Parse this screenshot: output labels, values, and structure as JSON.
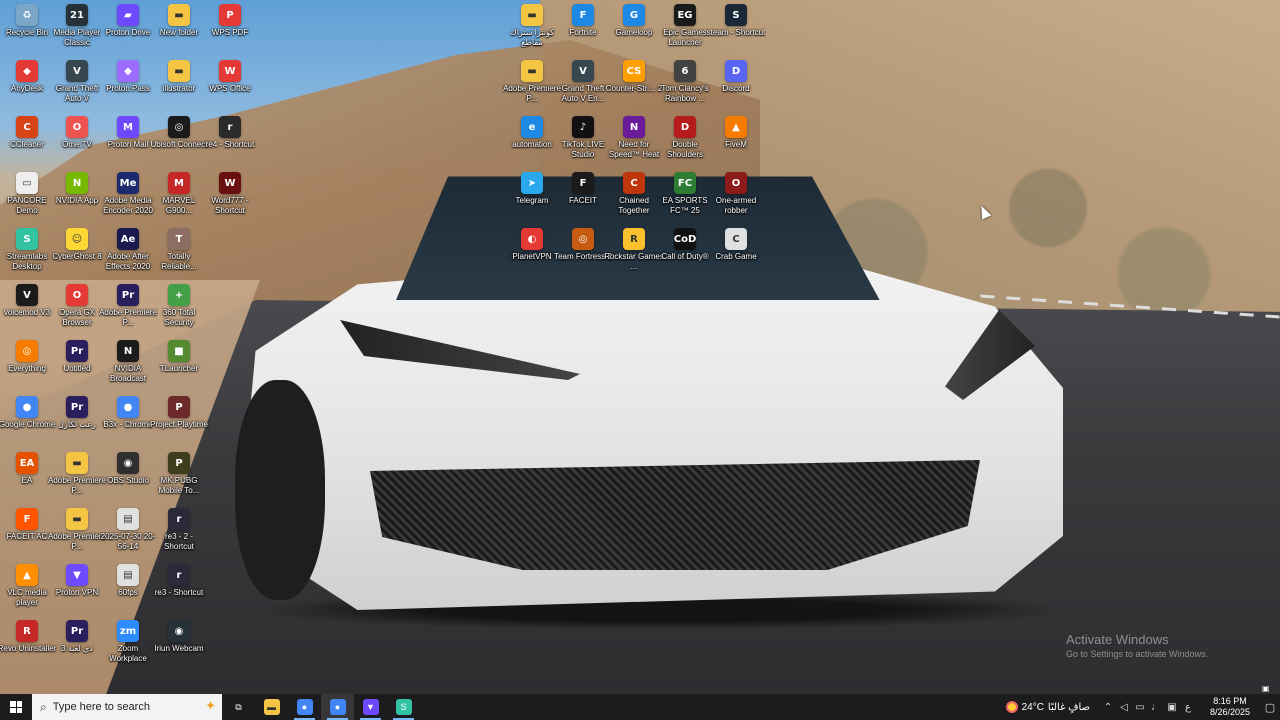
{
  "desktop_icons": [
    {
      "label": "Recycle Bin",
      "icon": "recycle-bin-icon",
      "color": "#7aa7c7",
      "glyph": "♻",
      "col": 0,
      "row": 0
    },
    {
      "label": "AnyDesk",
      "icon": "anydesk-icon",
      "color": "#e53935",
      "glyph": "◆",
      "col": 0,
      "row": 1
    },
    {
      "label": "CCleaner",
      "icon": "ccleaner-icon",
      "color": "#d84315",
      "glyph": "C",
      "col": 0,
      "row": 2
    },
    {
      "label": "PANCORE Demo",
      "icon": "document-icon",
      "color": "#eeeeee",
      "glyph": "▭",
      "col": 0,
      "row": 3
    },
    {
      "label": "Streamlabs Desktop",
      "icon": "streamlabs-icon",
      "color": "#31c3a2",
      "glyph": "S",
      "col": 0,
      "row": 4
    },
    {
      "label": "voicemod V3",
      "icon": "voicemod-icon",
      "color": "#1b1b1b",
      "glyph": "V",
      "col": 0,
      "row": 5
    },
    {
      "label": "Everything",
      "icon": "everything-icon",
      "color": "#f57c00",
      "glyph": "◎",
      "col": 0,
      "row": 6
    },
    {
      "label": "Google Chrome",
      "icon": "chrome-icon",
      "color": "#4285f4",
      "glyph": "●",
      "col": 0,
      "row": 7
    },
    {
      "label": "EA",
      "icon": "ea-icon",
      "color": "#e65100",
      "glyph": "EA",
      "col": 0,
      "row": 8
    },
    {
      "label": "FACEIT AC",
      "icon": "faceit-ac-icon",
      "color": "#ff5500",
      "glyph": "F",
      "col": 0,
      "row": 9
    },
    {
      "label": "VLC media player",
      "icon": "vlc-icon",
      "color": "#ff8f00",
      "glyph": "▲",
      "col": 0,
      "row": 10
    },
    {
      "label": "Revo Uninstaller",
      "icon": "revo-icon",
      "color": "#c62828",
      "glyph": "R",
      "col": 0,
      "row": 11
    },
    {
      "label": "Media Player Classic",
      "icon": "media-player-icon",
      "color": "#263238",
      "glyph": "21",
      "col": 1,
      "row": 0
    },
    {
      "label": "Grand Theft Auto V",
      "icon": "gta-icon",
      "color": "#37474f",
      "glyph": "V",
      "col": 1,
      "row": 1
    },
    {
      "label": "Ome.TV",
      "icon": "ome-tv-icon",
      "color": "#ef5350",
      "glyph": "O",
      "col": 1,
      "row": 2
    },
    {
      "label": "NVIDIA App",
      "icon": "nvidia-icon",
      "color": "#76b900",
      "glyph": "N",
      "col": 1,
      "row": 3
    },
    {
      "label": "CyberGhost 8",
      "icon": "cyberghost-icon",
      "color": "#fdd835",
      "glyph": "☺",
      "col": 1,
      "row": 4
    },
    {
      "label": "Opera GX Browser",
      "icon": "opera-gx-icon",
      "color": "#e53935",
      "glyph": "O",
      "col": 1,
      "row": 5
    },
    {
      "label": "Untitled",
      "icon": "premiere-icon",
      "color": "#2a1e5c",
      "glyph": "Pr",
      "col": 1,
      "row": 6
    },
    {
      "label": "رعب لكارل",
      "icon": "premiere-icon",
      "color": "#2a1e5c",
      "glyph": "Pr",
      "col": 1,
      "row": 7
    },
    {
      "label": "Adobe Premiere P...",
      "icon": "folder-icon",
      "color": "#f4c542",
      "glyph": "▬",
      "col": 1,
      "row": 8
    },
    {
      "label": "Adobe Premiere P...",
      "icon": "folder-icon",
      "color": "#f4c542",
      "glyph": "▬",
      "col": 1,
      "row": 9
    },
    {
      "label": "Proton VPN",
      "icon": "proton-vpn-icon",
      "color": "#6d4aff",
      "glyph": "▼",
      "col": 1,
      "row": 10
    },
    {
      "label": "3 دي لعبة",
      "icon": "premiere-icon",
      "color": "#2a1e5c",
      "glyph": "Pr",
      "col": 1,
      "row": 11
    },
    {
      "label": "Proton Drive",
      "icon": "proton-drive-icon",
      "color": "#6d4aff",
      "glyph": "▰",
      "col": 2,
      "row": 0
    },
    {
      "label": "Proton Pass",
      "icon": "proton-pass-icon",
      "color": "#9c6cff",
      "glyph": "◆",
      "col": 2,
      "row": 1
    },
    {
      "label": "Proton Mail",
      "icon": "proton-mail-icon",
      "color": "#6d4aff",
      "glyph": "M",
      "col": 2,
      "row": 2
    },
    {
      "label": "Adobe Media Encoder 2020",
      "icon": "media-encoder-icon",
      "color": "#1a2a6c",
      "glyph": "Me",
      "col": 2,
      "row": 3
    },
    {
      "label": "Adobe After Effects 2020",
      "icon": "after-effects-icon",
      "color": "#1a1a4e",
      "glyph": "Ae",
      "col": 2,
      "row": 4
    },
    {
      "label": "Adobe Premiere P...",
      "icon": "premiere-icon",
      "color": "#2a1e5c",
      "glyph": "Pr",
      "col": 2,
      "row": 5
    },
    {
      "label": "NVIDIA Broadcast",
      "icon": "nvidia-broadcast-icon",
      "color": "#1b1b1b",
      "glyph": "N",
      "col": 2,
      "row": 6
    },
    {
      "label": "B3x - Chrome",
      "icon": "chrome-icon",
      "color": "#4285f4",
      "glyph": "●",
      "col": 2,
      "row": 7
    },
    {
      "label": "OBS Studio",
      "icon": "obs-icon",
      "color": "#302e31",
      "glyph": "◉",
      "col": 2,
      "row": 8
    },
    {
      "label": "2025-07-30 20-56-14",
      "icon": "video-file-icon",
      "color": "#e0e0e0",
      "glyph": "▤",
      "col": 2,
      "row": 9
    },
    {
      "label": "60fps",
      "icon": "video-file-icon",
      "color": "#e0e0e0",
      "glyph": "▤",
      "col": 2,
      "row": 10
    },
    {
      "label": "Zoom Workplace",
      "icon": "zoom-icon",
      "color": "#2d8cff",
      "glyph": "zm",
      "col": 2,
      "row": 11
    },
    {
      "label": "New folder",
      "icon": "folder-icon",
      "color": "#f4c542",
      "glyph": "▬",
      "col": 3,
      "row": 0
    },
    {
      "label": "illustrator",
      "icon": "folder-icon",
      "color": "#f4c542",
      "glyph": "▬",
      "col": 3,
      "row": 1
    },
    {
      "label": "Ubisoft Connect",
      "icon": "ubisoft-icon",
      "color": "#1b1b1b",
      "glyph": "◎",
      "col": 3,
      "row": 2
    },
    {
      "label": "MARVEL G900...",
      "icon": "marvel-icon",
      "color": "#c62828",
      "glyph": "M",
      "col": 3,
      "row": 3
    },
    {
      "label": "Totally Reliable...",
      "icon": "game-icon",
      "color": "#8d6e63",
      "glyph": "T",
      "col": 3,
      "row": 4
    },
    {
      "label": "360 Total Security",
      "icon": "total-security-icon",
      "color": "#43a047",
      "glyph": "+",
      "col": 3,
      "row": 5
    },
    {
      "label": "TLauncher",
      "icon": "tlauncher-icon",
      "color": "#558b2f",
      "glyph": "■",
      "col": 3,
      "row": 6
    },
    {
      "label": "Project Playtime",
      "icon": "game-icon",
      "color": "#6d2a2a",
      "glyph": "P",
      "col": 3,
      "row": 7
    },
    {
      "label": "MK PUBG Mobile To...",
      "icon": "pubg-icon",
      "color": "#3e3e1e",
      "glyph": "P",
      "col": 3,
      "row": 8
    },
    {
      "label": "re3 - 2 - Shortcut",
      "icon": "game-icon",
      "color": "#2a2a3a",
      "glyph": "r",
      "col": 3,
      "row": 9
    },
    {
      "label": "re3 - Shortcut",
      "icon": "game-icon",
      "color": "#2a2a3a",
      "glyph": "r",
      "col": 3,
      "row": 10
    },
    {
      "label": "Iriun Webcam",
      "icon": "webcam-icon",
      "color": "#263238",
      "glyph": "◉",
      "col": 3,
      "row": 11
    },
    {
      "label": "WPS PDF",
      "icon": "wps-pdf-icon",
      "color": "#e53935",
      "glyph": "P",
      "col": 4,
      "row": 0
    },
    {
      "label": "WPS Office",
      "icon": "wps-office-icon",
      "color": "#e53935",
      "glyph": "W",
      "col": 4,
      "row": 1
    },
    {
      "label": "re4 - Shortcut",
      "icon": "game-icon",
      "color": "#2a2a2a",
      "glyph": "r",
      "col": 4,
      "row": 2
    },
    {
      "label": "Word777 - Shortcut",
      "icon": "game-icon",
      "color": "#6a1010",
      "glyph": "W",
      "col": 4,
      "row": 3
    },
    {
      "label": "كونترا ستراك مقاطع",
      "icon": "folder-icon",
      "color": "#f4c542",
      "glyph": "▬",
      "col": 10,
      "row": 0
    },
    {
      "label": "Adobe Premiere P...",
      "icon": "folder-icon",
      "color": "#f4c542",
      "glyph": "▬",
      "col": 10,
      "row": 1
    },
    {
      "label": "automation",
      "icon": "edge-icon",
      "color": "#1e88e5",
      "glyph": "e",
      "col": 10,
      "row": 2
    },
    {
      "label": "Telegram",
      "icon": "telegram-icon",
      "color": "#29a9eb",
      "glyph": "➤",
      "col": 10,
      "row": 3
    },
    {
      "label": "PlanetVPN",
      "icon": "planetvpn-icon",
      "color": "#e53935",
      "glyph": "◐",
      "col": 10,
      "row": 4
    },
    {
      "label": "Fortnite",
      "icon": "fortnite-icon",
      "color": "#1e88e5",
      "glyph": "F",
      "col": 11,
      "row": 0
    },
    {
      "label": "Grand Theft Auto V En...",
      "icon": "gta-icon",
      "color": "#37474f",
      "glyph": "V",
      "col": 11,
      "row": 1
    },
    {
      "label": "TikTok LIVE Studio",
      "icon": "tiktok-icon",
      "color": "#111111",
      "glyph": "♪",
      "col": 11,
      "row": 2
    },
    {
      "label": "FACEIT",
      "icon": "faceit-icon",
      "color": "#1b1b1b",
      "glyph": "F",
      "col": 11,
      "row": 3
    },
    {
      "label": "Team Fortress 2",
      "icon": "tf2-icon",
      "color": "#c75b12",
      "glyph": "◎",
      "col": 11,
      "row": 4
    },
    {
      "label": "Gameloop",
      "icon": "gameloop-icon",
      "color": "#1e88e5",
      "glyph": "G",
      "col": 12,
      "row": 0
    },
    {
      "label": "Counter-Stri... 2",
      "icon": "cs2-icon",
      "color": "#ffa000",
      "glyph": "CS",
      "col": 12,
      "row": 1
    },
    {
      "label": "Need for Speed™ Heat",
      "icon": "nfs-icon",
      "color": "#6a1b9a",
      "glyph": "N",
      "col": 12,
      "row": 2
    },
    {
      "label": "Chained Together",
      "icon": "game-icon",
      "color": "#bf360c",
      "glyph": "C",
      "col": 12,
      "row": 3
    },
    {
      "label": "Rockstar Games ...",
      "icon": "rockstar-icon",
      "color": "#fbc02d",
      "glyph": "R",
      "col": 12,
      "row": 4
    },
    {
      "label": "Epic Games Launcher",
      "icon": "epic-games-icon",
      "color": "#1b1b1b",
      "glyph": "EG",
      "col": 13,
      "row": 0
    },
    {
      "label": "Tom Clancy's Rainbow ...",
      "icon": "rainbow-six-icon",
      "color": "#424242",
      "glyph": "6",
      "col": 13,
      "row": 1
    },
    {
      "label": "Double Shoulders",
      "icon": "game-icon",
      "color": "#b71c1c",
      "glyph": "D",
      "col": 13,
      "row": 2
    },
    {
      "label": "EA SPORTS FC™ 25",
      "icon": "ea-fc-icon",
      "color": "#2e7d32",
      "glyph": "FC",
      "col": 13,
      "row": 3
    },
    {
      "label": "Call of Duty®",
      "icon": "cod-icon",
      "color": "#111111",
      "glyph": "CoD",
      "col": 13,
      "row": 4
    },
    {
      "label": "steam - Shortcut",
      "icon": "steam-icon",
      "color": "#1b2838",
      "glyph": "S",
      "col": 14,
      "row": 0
    },
    {
      "label": "Discord",
      "icon": "discord-icon",
      "color": "#5865f2",
      "glyph": "D",
      "col": 14,
      "row": 1
    },
    {
      "label": "FiveM",
      "icon": "fivem-icon",
      "color": "#f57c00",
      "glyph": "▲",
      "col": 14,
      "row": 2
    },
    {
      "label": "One-armed robber",
      "icon": "game-icon",
      "color": "#8e1b1b",
      "glyph": "O",
      "col": 14,
      "row": 3
    },
    {
      "label": "Crab Game",
      "icon": "crab-game-icon",
      "color": "#e0e0e0",
      "glyph": "C",
      "col": 14,
      "row": 4
    }
  ],
  "watermark": {
    "line1": "Activate Windows",
    "line2": "Go to Settings to activate Windows."
  },
  "taskbar": {
    "search_placeholder": "Type here to search",
    "apps": [
      {
        "name": "task-view",
        "icon": "task-view-icon",
        "glyph": "⧉",
        "color": "transparent",
        "state": "none"
      },
      {
        "name": "file-explorer",
        "icon": "folder-icon",
        "glyph": "▬",
        "color": "#f4c542",
        "state": "none"
      },
      {
        "name": "chrome",
        "icon": "chrome-icon",
        "glyph": "●",
        "color": "#4285f4",
        "state": "active"
      },
      {
        "name": "chrome-profile",
        "icon": "chrome-icon",
        "glyph": "●",
        "color": "#4285f4",
        "state": "running"
      },
      {
        "name": "proton-vpn",
        "icon": "proton-vpn-icon",
        "glyph": "▼",
        "color": "#6d4aff",
        "state": "active"
      },
      {
        "name": "streamlabs",
        "icon": "streamlabs-icon",
        "glyph": "S",
        "color": "#31c3a2",
        "state": "active"
      }
    ],
    "weather_temp": "24°C",
    "weather_desc": "صافٍ غالبًا",
    "lang": "ع",
    "time": "8:16 PM",
    "date": "8/26/2025"
  }
}
